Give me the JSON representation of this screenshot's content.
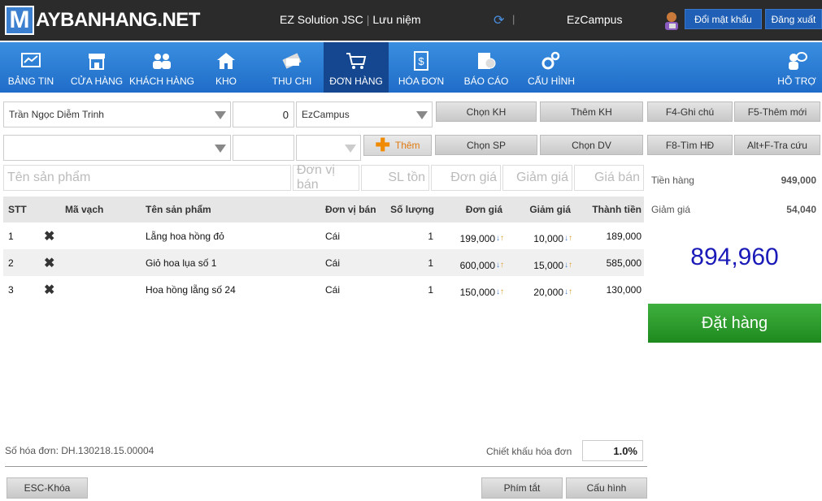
{
  "header": {
    "logo_m": "M",
    "logo_text": "AYBANHANG.NET",
    "company": "EZ Solution JSC",
    "category": "Lưu niệm",
    "store": "EzCampus",
    "change_password": "Đổi mật khẩu",
    "logout": "Đăng xuất"
  },
  "nav": [
    {
      "label": "BẢNG TIN",
      "icon": "dashboard-icon"
    },
    {
      "label": "CỬA HÀNG",
      "icon": "store-icon"
    },
    {
      "label": "KHÁCH HÀNG",
      "icon": "customers-icon"
    },
    {
      "label": "KHO",
      "icon": "warehouse-icon"
    },
    {
      "label": "THU CHI",
      "icon": "cash-icon"
    },
    {
      "label": "ĐƠN HÀNG",
      "icon": "cart-icon"
    },
    {
      "label": "HÓA ĐƠN",
      "icon": "invoice-icon"
    },
    {
      "label": "BÁO CÁO",
      "icon": "report-icon"
    },
    {
      "label": "CẤU HÌNH",
      "icon": "settings-icon"
    },
    {
      "label": "HỖ TRỢ",
      "icon": "support-icon"
    }
  ],
  "form": {
    "customer": "Trần Ngọc Diễm Trinh",
    "customer_qty": "0",
    "store": "EzCampus",
    "add_label": "Thêm",
    "buttons": {
      "chon_kh": "Chọn KH",
      "them_kh": "Thêm KH",
      "f4": "F4-Ghi chú",
      "f5": "F5-Thêm mới",
      "chon_sp": "Chọn SP",
      "chon_dv": "Chọn DV",
      "f8": "F8-Tìm HĐ",
      "alt_f": "Alt+F-Tra cứu"
    },
    "placeholders": {
      "product": "Tên sản phẩm",
      "unit": "Đơn vị bán",
      "stock": "SL tồn",
      "price": "Đơn giá",
      "discount": "Giảm giá",
      "sale_price": "Giá bán"
    }
  },
  "table": {
    "headers": {
      "stt": "STT",
      "barcode": "Mã vạch",
      "name": "Tên sản phẩm",
      "unit": "Đơn vị bán",
      "qty": "Số lượng",
      "price": "Đơn giá",
      "discount": "Giảm giá",
      "total": "Thành tiền"
    },
    "rows": [
      {
        "stt": "1",
        "name": "Lẵng hoa hồng đỏ",
        "unit": "Cái",
        "qty": "1",
        "price": "199,000",
        "discount": "10,000",
        "total": "189,000"
      },
      {
        "stt": "2",
        "name": "Giỏ hoa lụa số 1",
        "unit": "Cái",
        "qty": "1",
        "price": "600,000",
        "discount": "15,000",
        "total": "585,000"
      },
      {
        "stt": "3",
        "name": "Hoa hồng lẵng số 24",
        "unit": "Cái",
        "qty": "1",
        "price": "150,000",
        "discount": "20,000",
        "total": "130,000"
      }
    ]
  },
  "summary": {
    "subtotal_label": "Tiền hàng",
    "subtotal": "949,000",
    "discount_label": "Giảm giá",
    "discount": "54,040",
    "total": "894,960",
    "order_button": "Đặt hàng"
  },
  "footer": {
    "invoice_no": "Số hóa đơn: DH.130218.15.00004",
    "discount_label": "Chiết khấu hóa đơn",
    "discount_value": "1.0%",
    "esc": "ESC-Khóa",
    "shortcuts": "Phím tắt",
    "config": "Cấu hình"
  }
}
